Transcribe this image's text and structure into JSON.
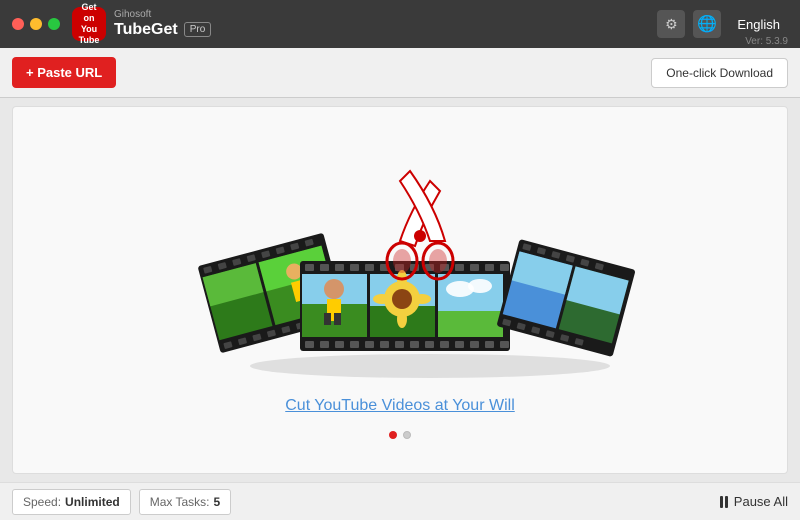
{
  "titleBar": {
    "company": "Gihosoft",
    "appName": "TubeGet",
    "badge": "Pro",
    "version": "Ver: 5.3.9",
    "language": "English",
    "gearIcon": "⚙",
    "langIcon": "EN"
  },
  "toolbar": {
    "pasteUrlLabel": "+ Paste URL",
    "oneClickLabel": "One-click Download"
  },
  "promo": {
    "title": "Cut YouTube Videos at Your Will",
    "dots": [
      true,
      false
    ]
  },
  "statusBar": {
    "speedLabel": "Speed:",
    "speedValue": "Unlimited",
    "maxTasksLabel": "Max Tasks:",
    "maxTasksValue": "5",
    "pauseAllLabel": "Pause All"
  },
  "windowControls": {
    "closeLabel": "close",
    "minLabel": "minimize",
    "maxLabel": "maximize"
  }
}
